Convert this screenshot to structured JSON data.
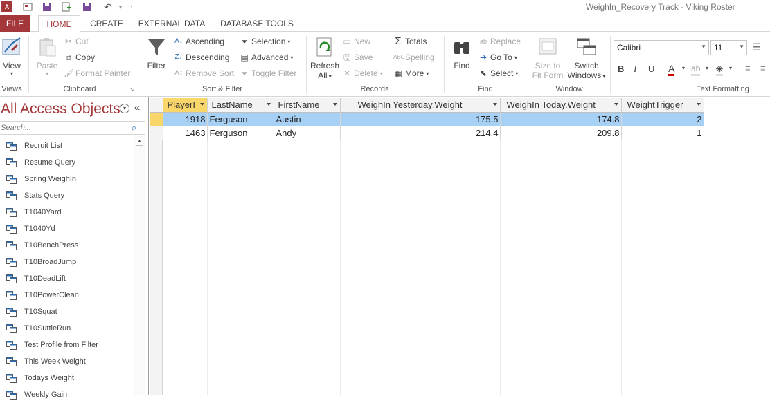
{
  "window": {
    "title": "WeighIn_Recovery Track - Viking Roster"
  },
  "tabs": [
    {
      "label": "FILE"
    },
    {
      "label": "HOME"
    },
    {
      "label": "CREATE"
    },
    {
      "label": "EXTERNAL DATA"
    },
    {
      "label": "DATABASE TOOLS"
    }
  ],
  "ribbon": {
    "views": {
      "view": "View",
      "group": "Views"
    },
    "clipboard": {
      "paste": "Paste",
      "cut": "Cut",
      "copy": "Copy",
      "format_painter": "Format Painter",
      "group": "Clipboard"
    },
    "sort_filter": {
      "filter": "Filter",
      "ascending": "Ascending",
      "descending": "Descending",
      "remove_sort": "Remove Sort",
      "selection": "Selection",
      "advanced": "Advanced",
      "toggle_filter": "Toggle Filter",
      "group": "Sort & Filter"
    },
    "records": {
      "refresh": "Refresh",
      "refresh2": "All",
      "new": "New",
      "save": "Save",
      "delete": "Delete",
      "totals": "Totals",
      "spelling": "Spelling",
      "more": "More",
      "group": "Records"
    },
    "find": {
      "find": "Find",
      "replace": "Replace",
      "goto": "Go To",
      "select": "Select",
      "group": "Find"
    },
    "window": {
      "size_to_fit": "Size to",
      "size_to_fit2": "Fit Form",
      "switch": "Switch",
      "switch2": "Windows",
      "group": "Window"
    },
    "text_formatting": {
      "font": "Calibri",
      "size": "11",
      "group": "Text Formatting"
    }
  },
  "nav": {
    "title": "All Access Objects",
    "search_placeholder": "Search...",
    "items": [
      {
        "label": "Recruit List"
      },
      {
        "label": "Resume Query"
      },
      {
        "label": "Spring WeighIn"
      },
      {
        "label": "Stats Query"
      },
      {
        "label": "T1040Yard"
      },
      {
        "label": "T1040Yd"
      },
      {
        "label": "T10BenchPress"
      },
      {
        "label": "T10BroadJump"
      },
      {
        "label": "T10DeadLift"
      },
      {
        "label": "T10PowerClean"
      },
      {
        "label": "T10Squat"
      },
      {
        "label": "T10SuttleRun"
      },
      {
        "label": "Test Profile from Filter"
      },
      {
        "label": "This Week Weight"
      },
      {
        "label": "Todays Weight"
      },
      {
        "label": "Weekly Gain"
      }
    ]
  },
  "grid": {
    "columns": [
      "PlayerI",
      "LastName",
      "FirstName",
      "WeighIn Yesterday.Weight",
      "WeighIn Today.Weight",
      "WeightTrigger"
    ],
    "rows": [
      [
        "1918",
        "Ferguson",
        "Austin",
        "175.5",
        "174.8",
        "2"
      ],
      [
        "1463",
        "Ferguson",
        "Andy",
        "214.4",
        "209.8",
        "1"
      ]
    ]
  },
  "colors": {
    "accent": "#a4373a",
    "selected_row": "#a7d0f5",
    "highlight": "#f9d66a"
  }
}
